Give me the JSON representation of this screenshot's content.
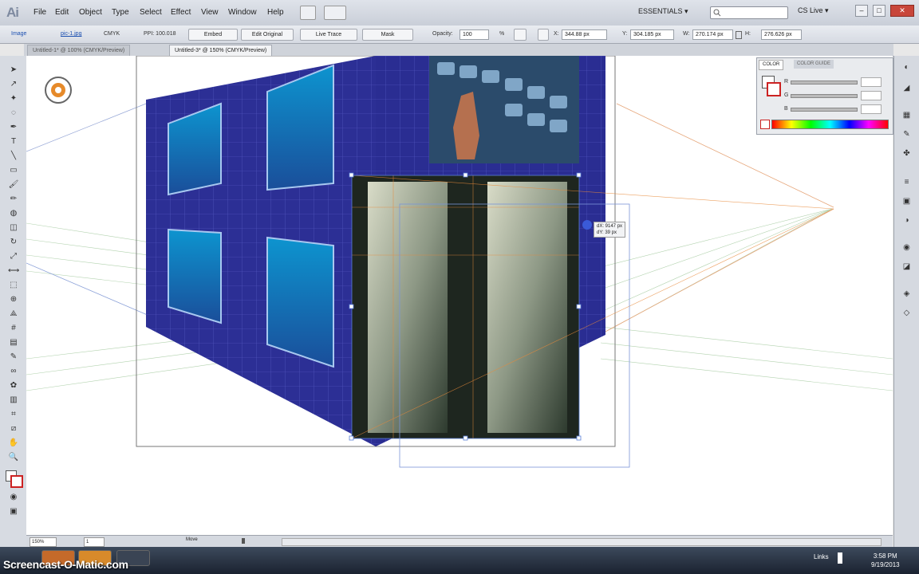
{
  "app": {
    "logo": "Ai",
    "workspace": "ESSENTIALS ▾",
    "cslive": "CS Live ▾"
  },
  "menu": [
    "File",
    "Edit",
    "Object",
    "Type",
    "Select",
    "Effect",
    "View",
    "Window",
    "Help"
  ],
  "control": {
    "selection": "Image",
    "link": "pic-1.jpg",
    "mode": "CMYK",
    "ppi": "PPI: 100.018",
    "embed": "Embed",
    "edit_original": "Edit Original",
    "live_trace": "Live Trace",
    "mask": "Mask",
    "opacity_label": "Opacity:",
    "opacity_value": "100",
    "opacity_unit": "%",
    "x_label": "X:",
    "x_value": "344.88 px",
    "y_label": "Y:",
    "y_value": "304.185 px",
    "w_label": "W:",
    "w_value": "270.174 px",
    "h_label": "H:",
    "h_value": "276.626 px"
  },
  "tabs": [
    {
      "label": "Untitled-1* @ 100% (CMYK/Preview)",
      "active": false
    },
    {
      "label": "Untitled-3* @ 150% (CMYK/Preview)",
      "active": true
    }
  ],
  "tooltip": {
    "dx": "dX: 9147 px",
    "dy": "dY: 39 px"
  },
  "color_panel": {
    "tabs": [
      "COLOR",
      "COLOR GUIDE"
    ],
    "channels": [
      "R",
      "G",
      "B"
    ]
  },
  "status": {
    "zoom": "150%",
    "artboard": "1",
    "tool": "Move"
  },
  "taskbar": {
    "watermark": "Screencast-O-Matic.com",
    "lang": "Links",
    "time": "3:58 PM",
    "date": "9/19/2013"
  },
  "colors": {
    "accent": "#2a2f8f",
    "window_glass": "#1ba7d6"
  }
}
